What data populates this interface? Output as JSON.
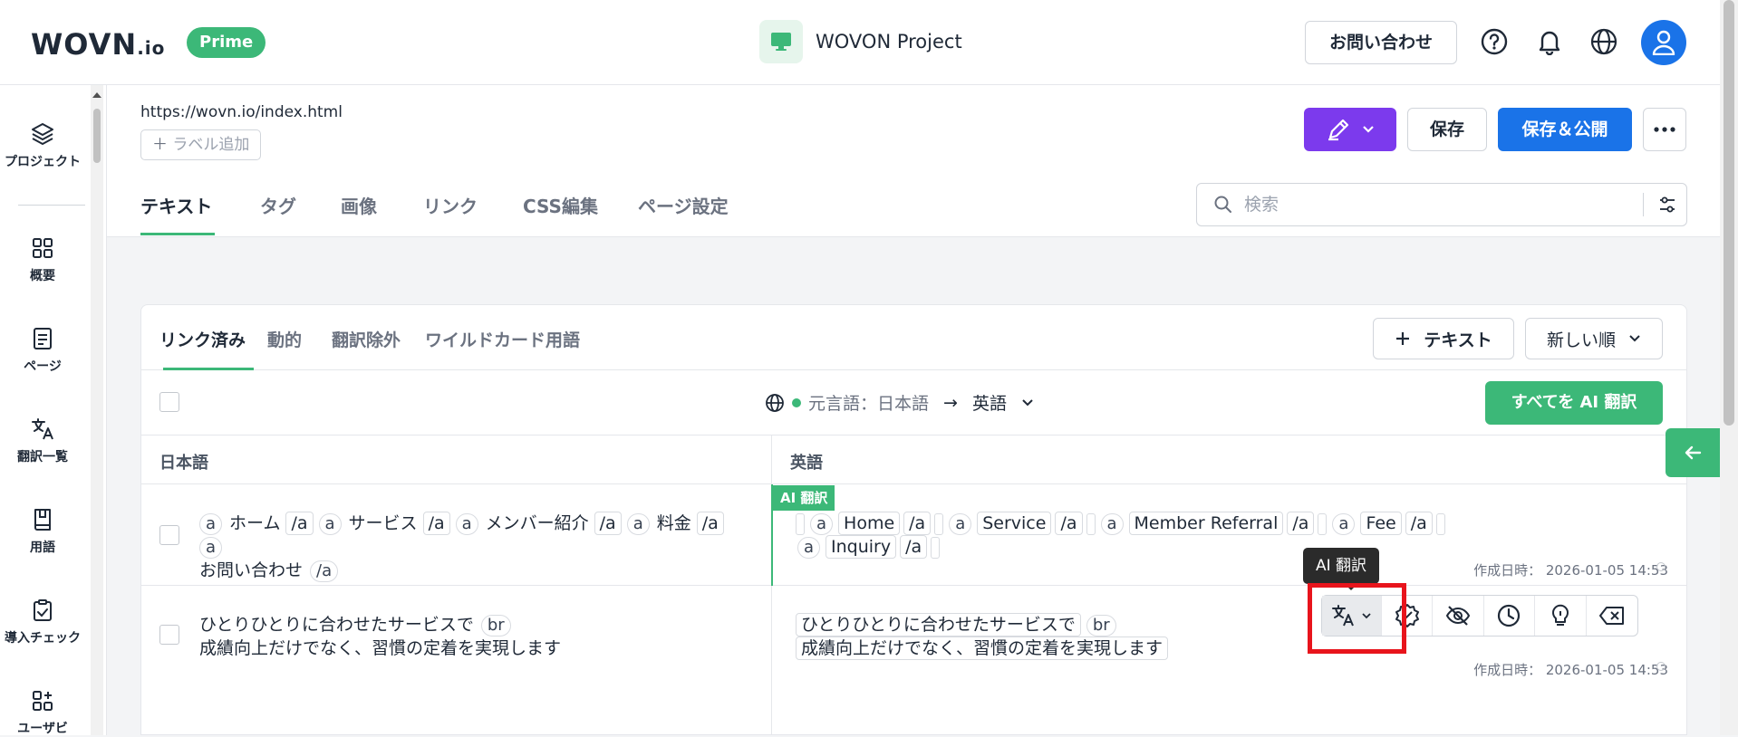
{
  "header": {
    "logo_main": "WOVN",
    "logo_suffix": ".io",
    "plan_badge": "Prime",
    "project_name": "WOVON Project",
    "contact_label": "お問い合わせ"
  },
  "sidebar": {
    "items": [
      {
        "label": "プロジェクト",
        "icon": "layers-icon"
      },
      {
        "label": "概要",
        "icon": "grid-icon"
      },
      {
        "label": "ページ",
        "icon": "document-icon"
      },
      {
        "label": "翻訳一覧",
        "icon": "translate-icon"
      },
      {
        "label": "用語",
        "icon": "book-icon"
      },
      {
        "label": "導入チェック",
        "icon": "clipboard-check-icon"
      },
      {
        "label": "ユーザビ",
        "icon": "add-grid-icon"
      }
    ]
  },
  "page": {
    "url": "https://wovn.io/index.html",
    "add_label": "ラベル追加",
    "save_label": "保存",
    "publish_label": "保存＆公開"
  },
  "tabs": [
    "テキスト",
    "タグ",
    "画像",
    "リンク",
    "CSS編集",
    "ページ設定"
  ],
  "search": {
    "placeholder": "検索"
  },
  "subtabs": [
    "リンク済み",
    "動的",
    "翻訳除外",
    "ワイルドカード用語"
  ],
  "add_text_label": "テキスト",
  "sort_label": "新しい順",
  "lang": {
    "source_prefix": "元言語：日本語",
    "arrow": "→",
    "target": "英語"
  },
  "ai_translate_all": "すべてを AI 翻訳",
  "columns": {
    "source": "日本語",
    "target": "英語"
  },
  "rows": [
    {
      "source_tokens": [
        {
          "t": "tag",
          "v": "a"
        },
        {
          "t": "text",
          "v": "ホーム"
        },
        {
          "t": "tagsq",
          "v": "/a"
        },
        {
          "t": "tag",
          "v": "a"
        },
        {
          "t": "text",
          "v": "サービス"
        },
        {
          "t": "tagsq",
          "v": "/a"
        },
        {
          "t": "tag",
          "v": "a"
        },
        {
          "t": "text",
          "v": "メンバー紹介"
        },
        {
          "t": "tagsq",
          "v": "/a"
        },
        {
          "t": "tag",
          "v": "a"
        },
        {
          "t": "text",
          "v": "料金"
        },
        {
          "t": "tagsq",
          "v": "/a"
        },
        {
          "t": "tag",
          "v": "a"
        },
        {
          "t": "br"
        },
        {
          "t": "text",
          "v": "お問い合わせ"
        },
        {
          "t": "tag",
          "v": "/a"
        }
      ],
      "created": "作成日時： 2026-01-05 14:53",
      "badge": "AI 翻訳",
      "target_tokens": [
        {
          "t": "thin"
        },
        {
          "t": "tag",
          "v": "a"
        },
        {
          "t": "sq",
          "v": "Home"
        },
        {
          "t": "tagsq",
          "v": "/a"
        },
        {
          "t": "thin"
        },
        {
          "t": "tag",
          "v": "a"
        },
        {
          "t": "sq",
          "v": "Service"
        },
        {
          "t": "tagsq",
          "v": "/a"
        },
        {
          "t": "thin"
        },
        {
          "t": "tag",
          "v": "a"
        },
        {
          "t": "sq",
          "v": "Member Referral"
        },
        {
          "t": "tagsq",
          "v": "/a"
        },
        {
          "t": "thin"
        },
        {
          "t": "tag",
          "v": "a"
        },
        {
          "t": "sq",
          "v": "Fee"
        },
        {
          "t": "tagsq",
          "v": "/a"
        },
        {
          "t": "thin"
        },
        {
          "t": "br"
        },
        {
          "t": "tag",
          "v": "a"
        },
        {
          "t": "sq",
          "v": "Inquiry"
        },
        {
          "t": "tagsq",
          "v": "/a"
        },
        {
          "t": "thin"
        }
      ]
    },
    {
      "source_tokens": [
        {
          "t": "text",
          "v": "ひとりひとりに合わせたサービスで"
        },
        {
          "t": "tag",
          "v": "br"
        },
        {
          "t": "br"
        },
        {
          "t": "text",
          "v": "成績向上だけでなく、習慣の定着を実現します"
        }
      ],
      "created": "作成日時： 2026-01-05 14:53",
      "target_tokens": [
        {
          "t": "sq",
          "v": "ひとりひとりに合わせたサービスで"
        },
        {
          "t": "tag",
          "v": "br"
        },
        {
          "t": "br"
        },
        {
          "t": "sq",
          "v": "成績向上だけでなく、習慣の定着を実現します"
        }
      ]
    }
  ],
  "tooltip": "AI 翻訳",
  "colors": {
    "brand_green": "#3cb878",
    "primary_blue": "#1a73e8",
    "edit_purple": "#7c3aed",
    "highlight_red": "#e8141c"
  }
}
